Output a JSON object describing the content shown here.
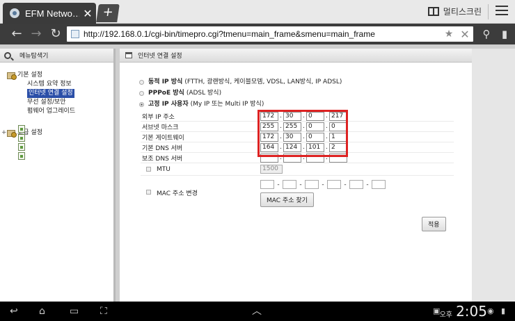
{
  "browser": {
    "tab_title": "EFM Netwo…",
    "tab_close": "✕",
    "new_tab": "+",
    "multiscreen_label": "멀티스크린",
    "url": "http://192.168.0.1/cgi-bin/timepro.cgi?tmenu=main_frame&smenu=main_frame"
  },
  "sidebar": {
    "title": "메뉴탐색기",
    "groups": [
      {
        "label": "기본 설정",
        "items": [
          "시스템 요약 정보",
          "인터넷 연결 설정",
          "무선 설정/보안",
          "펌웨어 업그레이드"
        ],
        "selected_index": 1
      },
      {
        "label": "고급 설정",
        "expander": "+"
      }
    ]
  },
  "main": {
    "title": "인터넷 연결 설정",
    "options": [
      {
        "bold": "동적 IP 방식",
        "desc": "(FTTH, 광랜방식, 케이블모뎀, VDSL, LAN방식, IP ADSL)",
        "selected": false
      },
      {
        "bold": "PPPoE 방식",
        "desc": "(ADSL 방식)",
        "selected": false
      },
      {
        "bold": "고정 IP 사용자",
        "desc": "(My IP 또는 Multi IP 방식)",
        "selected": true
      }
    ],
    "fields": {
      "ext_ip": {
        "label": "외부 IP 주소",
        "octets": [
          "172",
          "30",
          "0",
          "217"
        ]
      },
      "subnet": {
        "label": "서브넷 마스크",
        "octets": [
          "255",
          "255",
          "0",
          "0"
        ]
      },
      "gateway": {
        "label": "기본 게이트웨이",
        "octets": [
          "172",
          "30",
          "0",
          "1"
        ]
      },
      "dns1": {
        "label": "기본 DNS 서버",
        "octets": [
          "164",
          "124",
          "101",
          "2"
        ]
      },
      "dns2": {
        "label": "보조 DNS 서버",
        "octets": [
          "",
          "",
          "",
          ""
        ]
      }
    },
    "mtu": {
      "label": "MTU",
      "value": "1500"
    },
    "mac": {
      "label": "MAC 주소 변경",
      "find_button": "MAC 주소 찾기"
    },
    "apply_button": "적용"
  },
  "status_bar": {
    "ampm": "오후",
    "time": "2:05"
  },
  "colors": {
    "highlight_box": "#dd2222",
    "selected_menu": "#2b4fa8"
  }
}
